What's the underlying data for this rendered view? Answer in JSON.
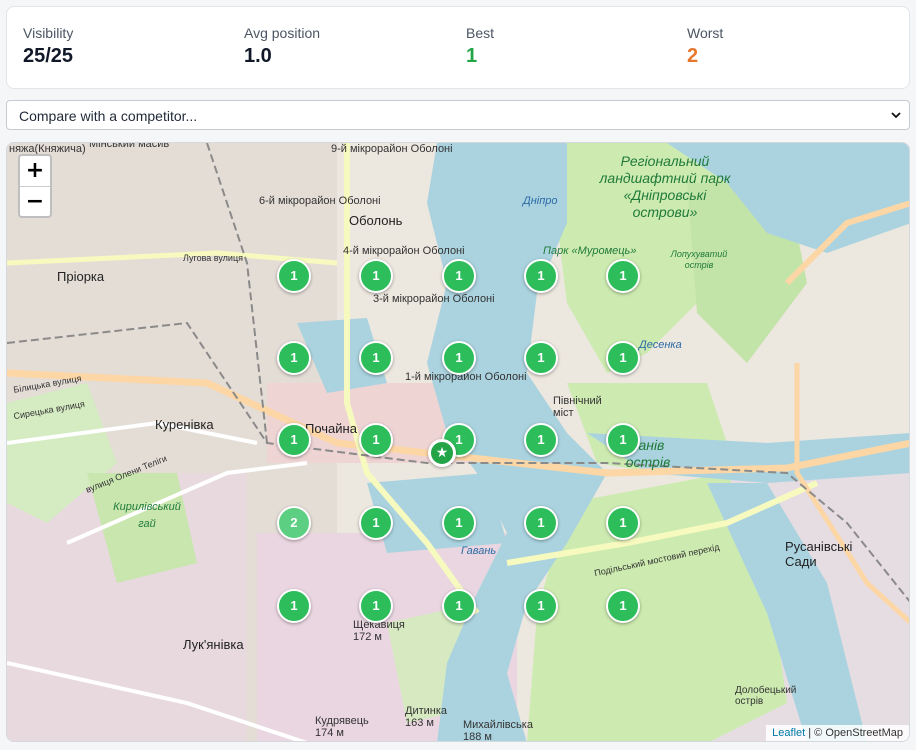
{
  "stats": {
    "visibility": {
      "label": "Visibility",
      "value": "25/25"
    },
    "avg_position": {
      "label": "Avg position",
      "value": "1.0"
    },
    "best": {
      "label": "Best",
      "value": "1"
    },
    "worst": {
      "label": "Worst",
      "value": "2"
    }
  },
  "compare": {
    "selected": "Compare with a competitor..."
  },
  "map": {
    "zoom_in": "+",
    "zoom_out": "−",
    "labels": {
      "minskyi": "Мінський масив",
      "kniazhycha": "няжа(Княжича)",
      "obolon": "Оболонь",
      "mikro9": "9-й мікрорайон Оболоні",
      "mikro6": "6-й мікрорайон Оболоні",
      "mikro4": "4-й мікрорайон Оболоні",
      "mikro3": "3-й мікрорайон Оболоні",
      "mikro1": "1-й мікрорайон Оболоні",
      "priorka": "Пріорка",
      "pochaina": "Почайна",
      "kurenivka": "Куренівка",
      "kyrylivskyi": "Кирилівський гай",
      "lukianivka": "Лук'янівка",
      "park_dnipro": "Регіональний ландшафтний парк «Дніпровські острови»",
      "park_muromets": "Парк «Муромець»",
      "lopukhuvatyi": "Лопухуватий острів",
      "desenka": "Десенка",
      "pivnichnyi": "Північний міст",
      "trukhaniv": "ханів острів",
      "rusanivski": "Русанівські Сади",
      "dnipro": "Дніпро",
      "dolobetskyi": "Долобецький острів",
      "shchekavytsia": "Щекавиця 172 м",
      "dytyna": "Дитинка 163 м",
      "kudriavets": "Кудрявець 174 м",
      "mykhailivska": "Михайлівська 188 м",
      "hromadska": "Гавань",
      "lugova": "Лугова вулиця",
      "bilytska": "Білицька вулиця",
      "syretska": "Сирецька вулиця",
      "olena_teliha": "вулиця Олени Теліги",
      "podilskyi": "Подільський мостовий перехід"
    },
    "pins": [
      {
        "rank": "1"
      },
      {
        "rank": "1"
      },
      {
        "rank": "1"
      },
      {
        "rank": "1"
      },
      {
        "rank": "1"
      },
      {
        "rank": "1"
      },
      {
        "rank": "1"
      },
      {
        "rank": "1"
      },
      {
        "rank": "1"
      },
      {
        "rank": "1"
      },
      {
        "rank": "1"
      },
      {
        "rank": "1"
      },
      {
        "rank": "1"
      },
      {
        "rank": "1"
      },
      {
        "rank": "1"
      },
      {
        "rank": "2"
      },
      {
        "rank": "1"
      },
      {
        "rank": "1"
      },
      {
        "rank": "1"
      },
      {
        "rank": "1"
      },
      {
        "rank": "1"
      },
      {
        "rank": "1"
      },
      {
        "rank": "1"
      },
      {
        "rank": "1"
      },
      {
        "rank": "1"
      }
    ],
    "business_icon": "star-icon",
    "attribution": {
      "leaflet": "Leaflet",
      "rest": "| © OpenStreetMap"
    }
  }
}
